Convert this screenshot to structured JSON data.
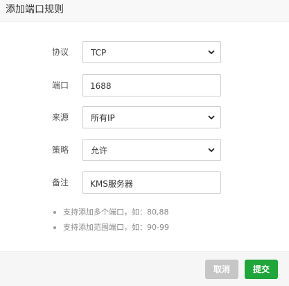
{
  "dialog": {
    "title": "添加端口规则"
  },
  "form": {
    "protocol": {
      "label": "协议",
      "value": "TCP",
      "icon": "chevron-down-icon"
    },
    "port": {
      "label": "端口",
      "value": "1688"
    },
    "source": {
      "label": "来源",
      "value": "所有IP",
      "icon": "chevron-down-icon"
    },
    "policy": {
      "label": "策略",
      "value": "允许",
      "icon": "chevron-down-icon"
    },
    "remark": {
      "label": "备注",
      "value": "KMS服务器"
    }
  },
  "tips": [
    "支持添加多个端口，如：80,88",
    "支持添加范围端口，如：90-99"
  ],
  "footer": {
    "cancel_label": "取消",
    "submit_label": "提交"
  },
  "colors": {
    "submit": "#20a53a",
    "cancel": "#c6c6c6",
    "header_bg": "#f8f8f8"
  }
}
